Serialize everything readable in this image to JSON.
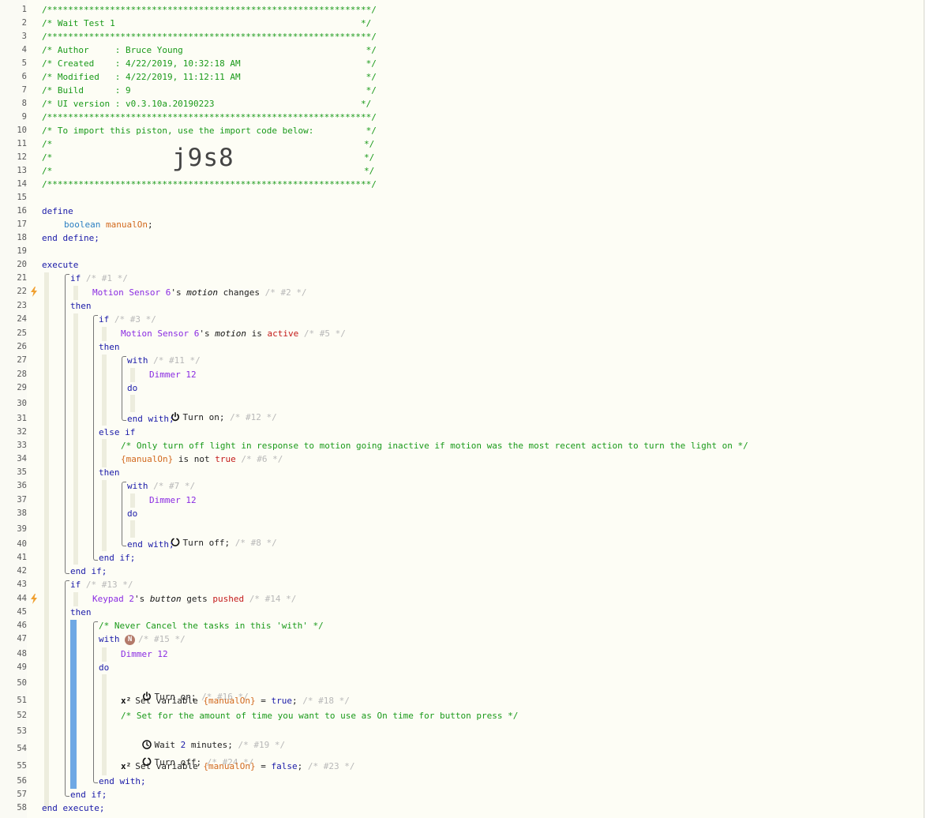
{
  "editor": {
    "line_numbers": [
      "1",
      "2",
      "3",
      "4",
      "5",
      "6",
      "7",
      "8",
      "9",
      "10",
      "11",
      "12",
      "13",
      "14",
      "15",
      "16",
      "17",
      "18",
      "19",
      "20",
      "21",
      "22",
      "23",
      "24",
      "25",
      "26",
      "27",
      "28",
      "29",
      "30",
      "31",
      "32",
      "33",
      "34",
      "35",
      "36",
      "37",
      "38",
      "39",
      "40",
      "41",
      "42",
      "43",
      "44",
      "45",
      "46",
      "47",
      "48",
      "49",
      "50",
      "51",
      "52",
      "53",
      "54",
      "55",
      "56",
      "57",
      "58"
    ],
    "header": {
      "border": "/**************************************************************/",
      "title": "/* Wait Test 1                                               */",
      "author": "/* Author     : Bruce Young                                   */",
      "created": "/* Created    : 4/22/2019, 10:32:18 AM                        */",
      "modified": "/* Modified   : 4/22/2019, 11:12:11 AM                        */",
      "build": "/* Build      : 9                                             */",
      "ui_version": "/* UI version : v0.3.10a.20190223                            */",
      "import_note": "/* To import this piston, use the import code below:          */",
      "blank_left": "/*",
      "blank_right": "*/",
      "import_code": "j9s8"
    },
    "code": {
      "define": "define",
      "boolean": "boolean",
      "manual_on": "manualOn",
      "semicolon": ";",
      "end_define": "end define;",
      "execute": "execute",
      "if": "if",
      "then": "then",
      "else_if": "else if",
      "with": "with",
      "do": "do",
      "end_with": "end with;",
      "end_if": "end if;",
      "end_execute": "end execute;",
      "c1": "/* #1 */",
      "motion_sensor": "Motion Sensor 6",
      "apostrophe_s": "'s",
      "motion": "motion",
      "changes": "changes",
      "c2": "/* #2 */",
      "c3": "/* #3 */",
      "is": "is",
      "active": "active",
      "c5": "/* #5 */",
      "c11": "/* #11 */",
      "dimmer": "Dimmer 12",
      "turn_on": "Turn on;",
      "c12": "/* #12 */",
      "note_only": "/* Only turn off light in response to motion going inactive if motion was the most recent action to turn the light on */",
      "manual_on_braced": "{manualOn}",
      "is_not": "is not",
      "true": "true",
      "c6": "/* #6 */",
      "c7": "/* #7 */",
      "turn_off": "Turn off;",
      "c8": "/* #8 */",
      "c13": "/* #13 */",
      "keypad": "Keypad 2",
      "button": "button",
      "gets": "gets",
      "pushed": "pushed",
      "c14": "/* #14 */",
      "note_never": "/* Never Cancel the tasks in this 'with' */",
      "badge_n": "N",
      "c15": "/* #15 */",
      "c16": "/* #16 */",
      "x2": "x²",
      "set_variable": "Set variable",
      "equals": "=",
      "true_val": "true",
      "c18": "/* #18 */",
      "note_set": "/* Set for the amount of time you want to use as On time for button press */",
      "wait": "Wait",
      "wait_amount": "2",
      "minutes": "minutes;",
      "c19": "/* #19 */",
      "c24": "/* #24 */",
      "false_val": "false",
      "c23": "/* #23 */"
    },
    "icons": {
      "trigger": "lightning-bolt-icon",
      "power_on": "power-icon",
      "power_off": "power-off-icon",
      "wait": "clock-icon"
    },
    "colors": {
      "comment": "#1a9a1a",
      "keyword": "#1a1aa8",
      "device": "#8a2be2",
      "variable": "#d2691e",
      "value": "#c41a1a",
      "trigger_bolt": "#f0a030",
      "async_bar": "#6ea8e4"
    }
  }
}
